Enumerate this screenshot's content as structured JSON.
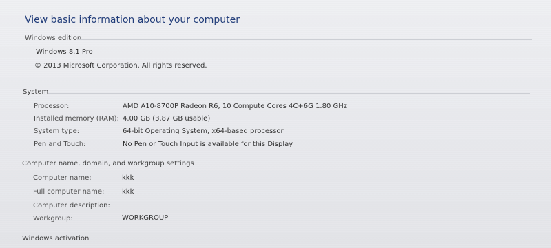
{
  "page": {
    "title": "View basic information about your computer"
  },
  "windows_edition": {
    "header": "Windows edition",
    "edition": "Windows 8.1 Pro",
    "copyright": "© 2013 Microsoft Corporation. All rights reserved."
  },
  "system": {
    "header": "System",
    "rows": [
      {
        "label": "Processor:",
        "value": "AMD A10-8700P Radeon R6, 10 Compute Cores 4C+6G   1.80 GHz"
      },
      {
        "label": "Installed memory (RAM):",
        "value": "4.00 GB (3.87 GB usable)"
      },
      {
        "label": "System type:",
        "value": "64-bit Operating System, x64-based processor"
      },
      {
        "label": "Pen and Touch:",
        "value": "No Pen or Touch Input is available for this Display"
      }
    ]
  },
  "computer_name": {
    "header": "Computer name, domain, and workgroup settings",
    "rows": [
      {
        "label": "Computer name:",
        "value": "kkk"
      },
      {
        "label": "Full computer name:",
        "value": "kkk"
      },
      {
        "label": "Computer description:",
        "value": ""
      },
      {
        "label": "Workgroup:",
        "value": "WORKGROUP"
      }
    ]
  },
  "windows_activation": {
    "header": "Windows activation"
  }
}
